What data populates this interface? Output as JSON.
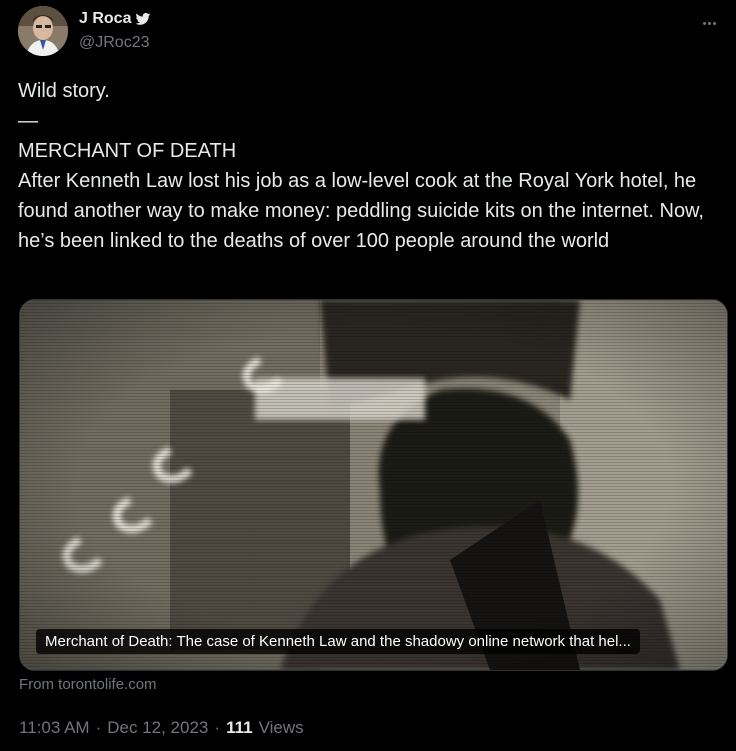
{
  "author": {
    "name": "J Roca",
    "handle": "@JRoc23",
    "badge_icon": "bird-icon"
  },
  "tweet": {
    "text": "Wild story.\n—\nMERCHANT OF DEATH\nAfter Kenneth Law lost his job as a low-level cook at the Royal York hotel, he found another way to make money: peddling suicide kits on the internet. Now, he’s been linked to the deaths of over 100 people around the world"
  },
  "card": {
    "caption": "Merchant of Death: The case of Kenneth Law and the shadowy online network that hel...",
    "source": "From torontolife.com"
  },
  "meta": {
    "time": "11:03 AM",
    "separator": "·",
    "date": "Dec 12, 2023",
    "views_count": "111",
    "views_label": "Views"
  },
  "colors": {
    "background": "#000000",
    "text": "#e7e9ea",
    "secondary": "#71767b"
  }
}
